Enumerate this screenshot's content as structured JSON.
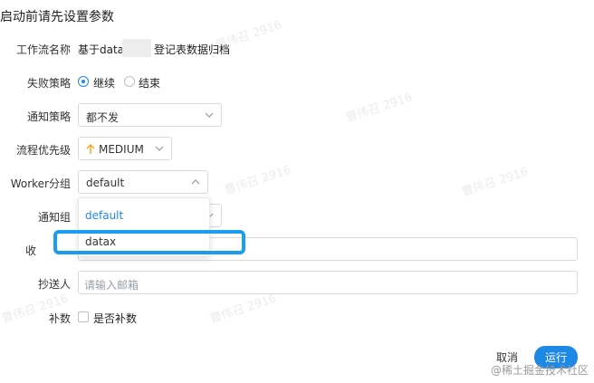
{
  "dialog": {
    "title": "启动前请先设置参数",
    "fields": {
      "workflow_name": {
        "label": "工作流名称",
        "value_prefix": "基于data",
        "value_suffix": "登记表数据归档"
      },
      "failure_strategy": {
        "label": "失败策略",
        "option_continue": "继续",
        "option_end": "结束",
        "selected": "继续"
      },
      "notify_strategy": {
        "label": "通知策略",
        "value": "都不发"
      },
      "process_priority": {
        "label": "流程优先级",
        "value": "MEDIUM"
      },
      "worker_group": {
        "label": "Worker分组",
        "value": "default"
      },
      "notify_group": {
        "label": "通知组"
      },
      "recipient": {
        "label_visible": "收"
      },
      "cc": {
        "label": "抄送人",
        "placeholder": "请输入邮箱"
      },
      "complement": {
        "label": "补数",
        "checkbox_label": "是否补数"
      }
    },
    "dropdown": {
      "options": [
        "default",
        "datax"
      ],
      "selected": "default"
    },
    "buttons": {
      "cancel": "取消",
      "run": "运行"
    }
  },
  "watermark": {
    "text": "曹伟召 2916"
  },
  "brand": {
    "text": "@稀土掘金技术社区"
  },
  "colors": {
    "accent": "#1e88e5",
    "highlight": "#1a9cf0",
    "priority_arrow": "#f5a623"
  },
  "icons": [
    "chevron-down-icon",
    "chevron-up-icon",
    "arrow-up-icon"
  ]
}
